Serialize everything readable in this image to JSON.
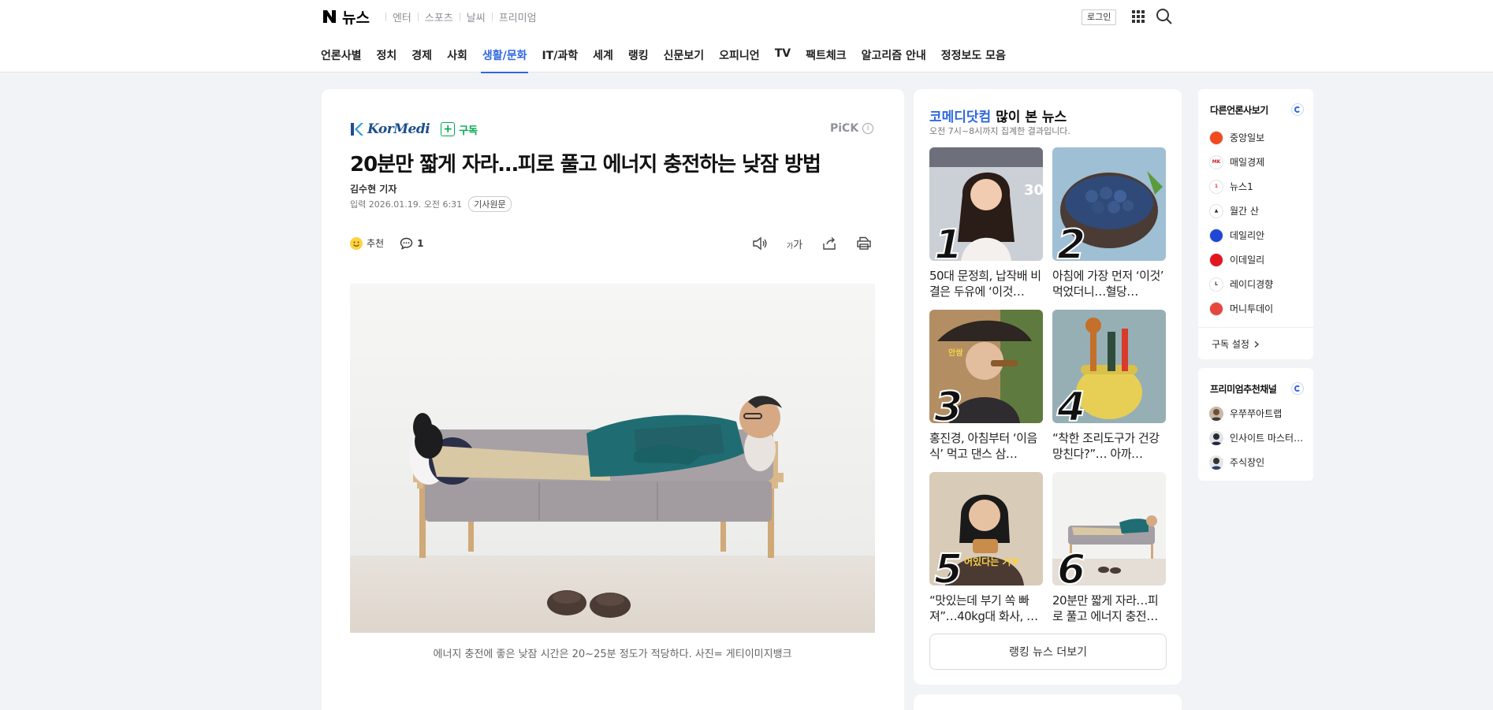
{
  "header": {
    "logo_letter": "N",
    "service_name": "뉴스",
    "service_links": [
      "엔터",
      "스포츠",
      "날씨",
      "프리미엄"
    ],
    "login_label": "로그인"
  },
  "nav": {
    "items": [
      "언론사별",
      "정치",
      "경제",
      "사회",
      "생활/문화",
      "IT/과학",
      "세계",
      "랭킹",
      "신문보기",
      "오피니언",
      "TV",
      "팩트체크",
      "알고리즘 안내",
      "정정보도 모음"
    ],
    "active_item": "생활/문화"
  },
  "article": {
    "press_name": "KorMedi",
    "subscribe_label": "구독",
    "pick_label": "PiCK",
    "title": "20분만 짧게 자라…피로 풀고 에너지 충전하는 낮잠 방법",
    "author": "김수현 기자",
    "date_label": "입력",
    "date": "2026.01.19. 오전 6:31",
    "origin_label": "기사원문",
    "recommend_label": "추천",
    "comment_count": "1",
    "font_size_label": "가",
    "caption": "에너지 충전에 좋은 낮잠 시간은 20~25분 정도가 적당하다. 사진= 게티이미지뱅크"
  },
  "ranking": {
    "press_name": "코메디닷컴",
    "title_suffix": "많이 본 뉴스",
    "subtitle": "오전 7시~8시까지 집계한 결과입니다.",
    "items": [
      {
        "rank": "1",
        "text": "50대 문정희, 납작배 비결은 두유에 ‘이것…"
      },
      {
        "rank": "2",
        "text": "아침에 가장 먼저 ‘이것’ 먹었더니…혈당…"
      },
      {
        "rank": "3",
        "text": "홍진경, 아침부터 ‘이음식’ 먹고 댄스 삼…"
      },
      {
        "rank": "4",
        "text": "“착한 조리도구가 건강 망친다?”… 아까…"
      },
      {
        "rank": "5",
        "text": "“맛있는데 부기 쏙 빠져”…40kg대 화사, …"
      },
      {
        "rank": "6",
        "text": "20분만 짧게 자라…피로 풀고 에너지 충전…"
      }
    ],
    "thumb_overlays": {
      "t3": "안쌈",
      "t5": "어있다는 거♥"
    },
    "more_label": "랭킹 뉴스 더보기"
  },
  "sidebar": {
    "press_card": {
      "title": "다른언론사보기",
      "items": [
        "중앙일보",
        "매일경제",
        "뉴스1",
        "월간 산",
        "데일리안",
        "이데일리",
        "레이디경향",
        "머니투데이"
      ],
      "footer": "구독 설정"
    },
    "premium_card": {
      "title": "프리미엄추천채널",
      "items": [
        "우쭈쭈아트랩",
        "인사이트 마스터…",
        "주식장인"
      ]
    }
  },
  "colors": {
    "accent": "#2f68e0",
    "subscribe_green": "#03a94f",
    "page_bg": "#f1f3f6"
  }
}
